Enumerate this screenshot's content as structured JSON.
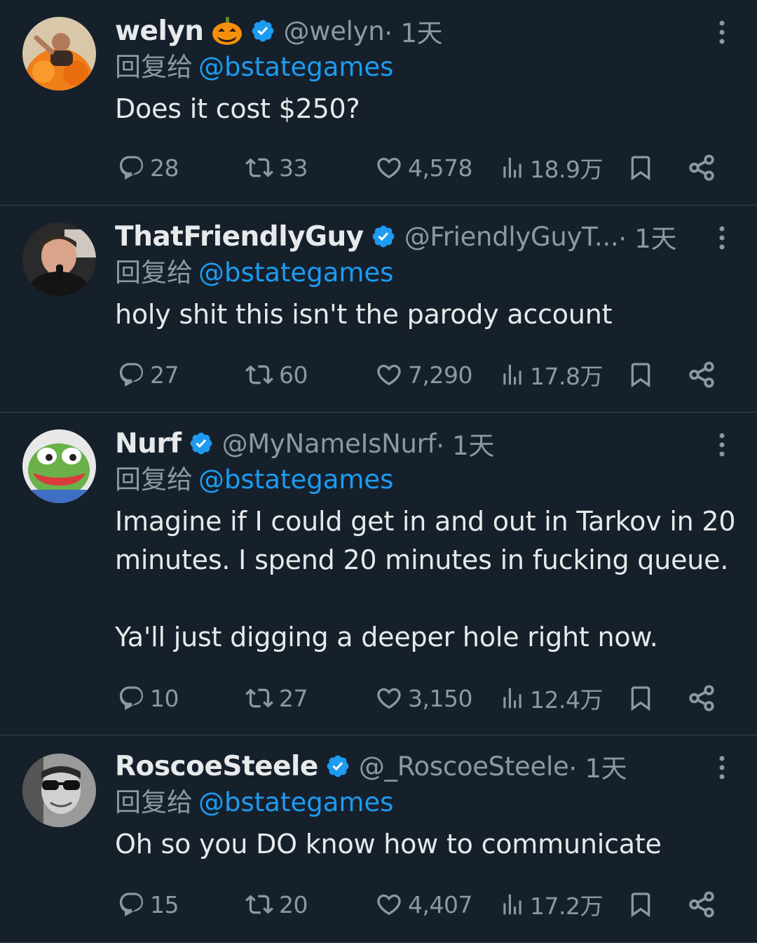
{
  "colors": {
    "background": "#15202b",
    "text": "#e7e9ea",
    "muted": "#8b98a5",
    "accent": "#1d9bf0",
    "divider": "#38444d"
  },
  "reply_prefix": "回复给",
  "tweets": [
    {
      "name": "welyn",
      "emoji": "jack-o-lantern",
      "handle": "@welyn",
      "time": " · 1天",
      "reply_to": "@bstategames",
      "text": "Does it cost $250?",
      "replies": "28",
      "retweets": "33",
      "likes": "4,578",
      "views": "18.9万"
    },
    {
      "name": "ThatFriendlyGuy",
      "handle": "@FriendlyGuyT...",
      "time": " · 1天",
      "reply_to": "@bstategames",
      "text": "holy shit this isn't the parody account",
      "replies": "27",
      "retweets": "60",
      "likes": "7,290",
      "views": "17.8万"
    },
    {
      "name": "Nurf",
      "handle": "@MyNameIsNurf",
      "time": " · 1天",
      "reply_to": "@bstategames",
      "text": "Imagine if I could get in and out in Tarkov in 20 minutes. I spend 20 minutes in fucking queue.\n\nYa'll just digging a deeper hole right now.",
      "replies": "10",
      "retweets": "27",
      "likes": "3,150",
      "views": "12.4万"
    },
    {
      "name": "RoscoeSteele",
      "handle": "@_RoscoeSteele",
      "time": " · 1天",
      "reply_to": "@bstategames",
      "text": "Oh so you DO know how to communicate",
      "replies": "15",
      "retweets": "20",
      "likes": "4,407",
      "views": "17.2万"
    }
  ]
}
